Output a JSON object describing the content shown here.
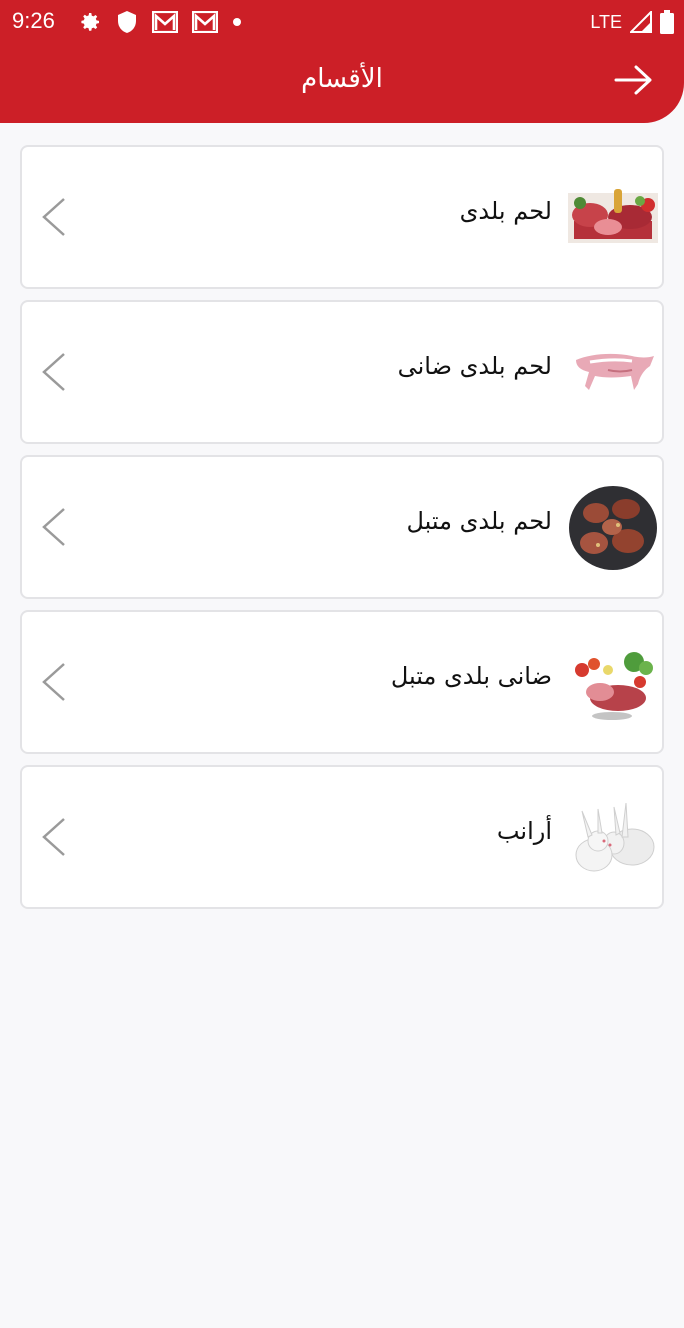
{
  "status_bar": {
    "time": "9:26",
    "network": "LTE",
    "icons_left": [
      "gear-icon",
      "shield-icon",
      "gmail-icon",
      "gmail-icon",
      "dot-icon"
    ],
    "icons_right": [
      "signal-icon",
      "battery-icon"
    ]
  },
  "header": {
    "title": "الأقسام",
    "back_icon": "arrow-right-icon",
    "color": "#cc1f27"
  },
  "categories": [
    {
      "label": "لحم بلدى",
      "image": "meat-assortment-image"
    },
    {
      "label": "لحم بلدى ضانى",
      "image": "lamb-carcass-image"
    },
    {
      "label": "لحم بلدى متبل",
      "image": "grilled-meat-image"
    },
    {
      "label": "ضانى بلدى متبل",
      "image": "meat-vegetables-image"
    },
    {
      "label": "أرانب",
      "image": "rabbits-image"
    }
  ]
}
